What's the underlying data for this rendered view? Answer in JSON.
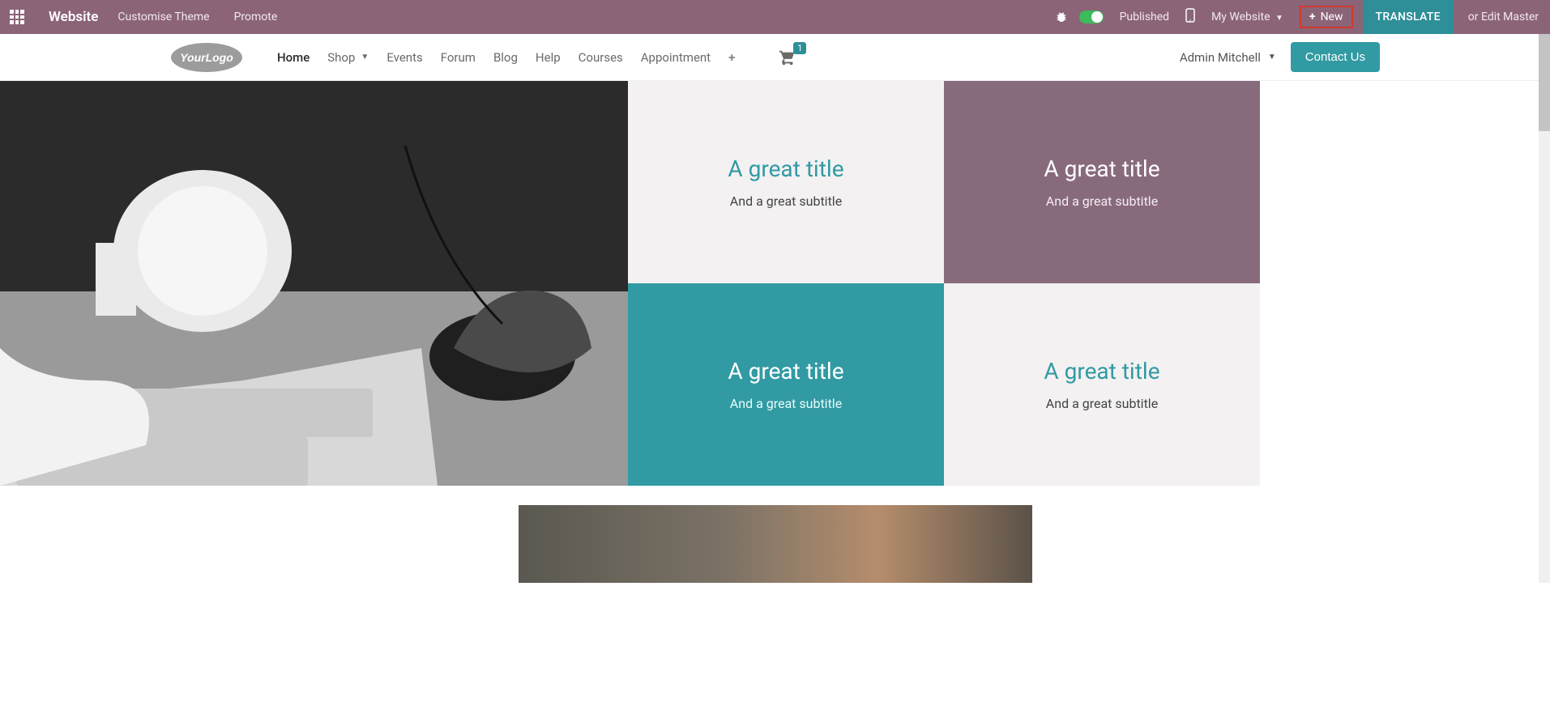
{
  "top_bar": {
    "brand": "Website",
    "customise": "Customise Theme",
    "promote": "Promote",
    "published": "Published",
    "my_website": "My Website",
    "new": "New",
    "translate": "TRANSLATE",
    "edit_master": "or Edit Master"
  },
  "nav": {
    "items": [
      "Home",
      "Shop",
      "Events",
      "Forum",
      "Blog",
      "Help",
      "Courses",
      "Appointment"
    ],
    "active_index": 0
  },
  "cart_count": "1",
  "user_name": "Admin Mitchell",
  "contact_label": "Contact Us",
  "tiles": [
    {
      "title": "A great title",
      "subtitle": "And a great subtitle"
    },
    {
      "title": "A great title",
      "subtitle": "And a great subtitle"
    },
    {
      "title": "A great title",
      "subtitle": "And a great subtitle"
    },
    {
      "title": "A great title",
      "subtitle": "And a great subtitle"
    }
  ],
  "colors": {
    "topbar": "#8b6478",
    "teal": "#319aa3",
    "purple_tile": "#886a7d",
    "highlight_border": "#d0392e"
  }
}
